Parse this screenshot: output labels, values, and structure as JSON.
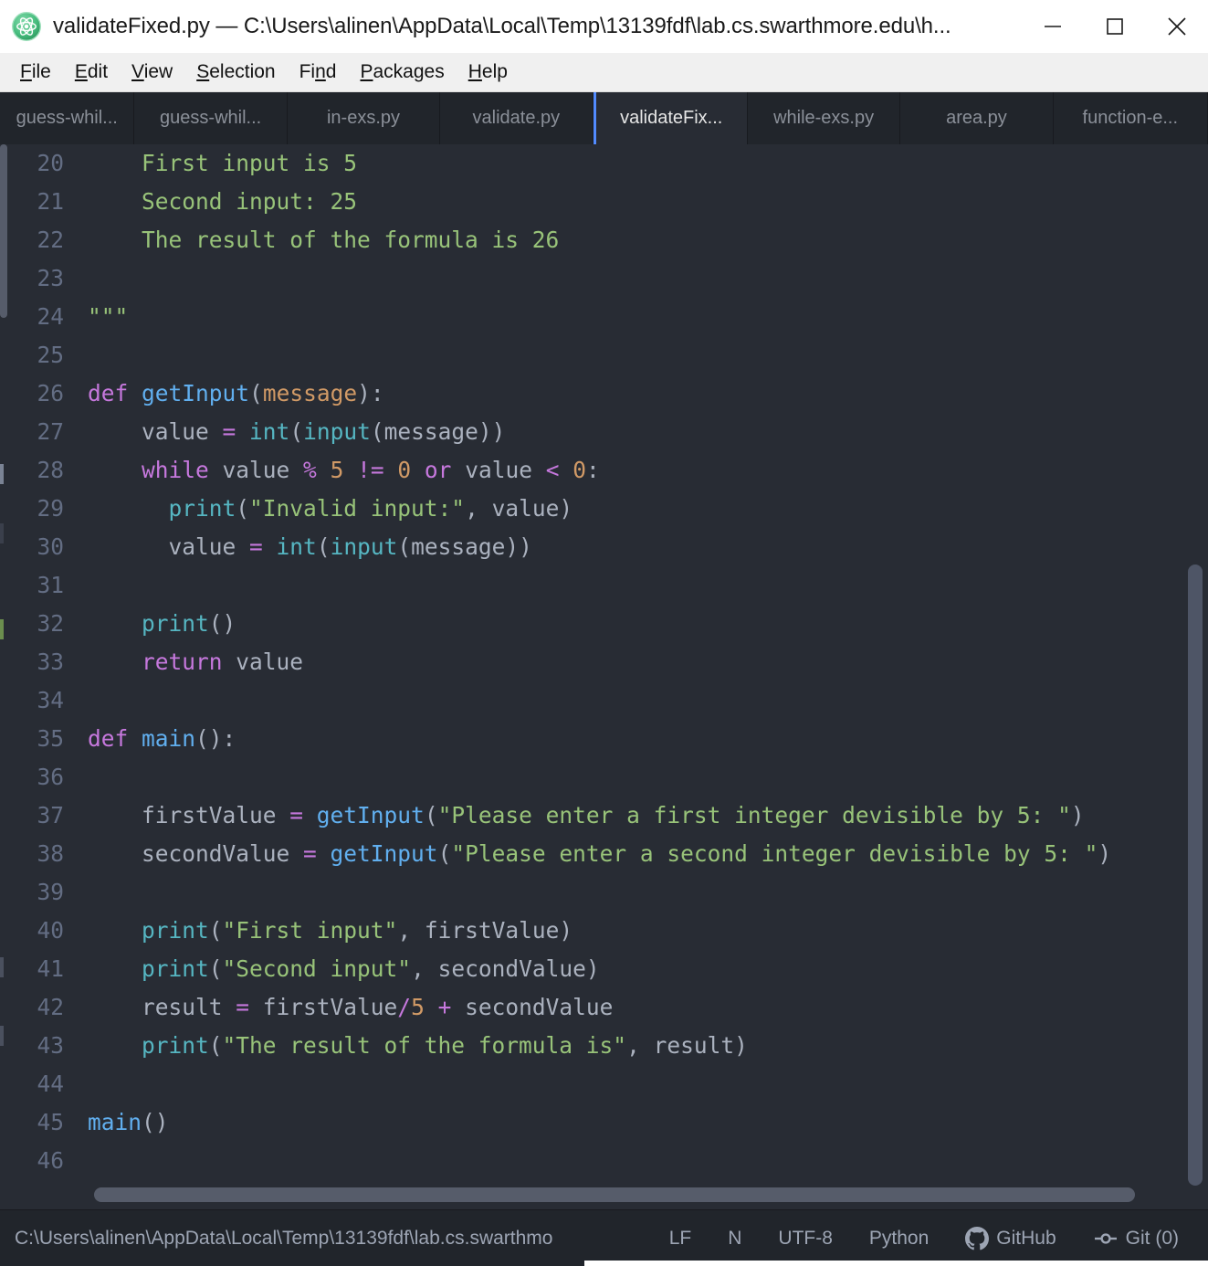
{
  "window": {
    "title": "validateFixed.py — C:\\Users\\alinen\\AppData\\Local\\Temp\\13139fdf\\lab.cs.swarthmore.edu\\h...",
    "app_icon": "atom-icon",
    "minimize_label": "−",
    "maximize_label": "□",
    "close_label": "✕"
  },
  "menu": {
    "items": [
      {
        "label": "File",
        "mnemonic": "F"
      },
      {
        "label": "Edit",
        "mnemonic": "E"
      },
      {
        "label": "View",
        "mnemonic": "V"
      },
      {
        "label": "Selection",
        "mnemonic": "S"
      },
      {
        "label": "Find",
        "mnemonic": "n"
      },
      {
        "label": "Packages",
        "mnemonic": "P"
      },
      {
        "label": "Help",
        "mnemonic": "H"
      }
    ]
  },
  "tabs": [
    {
      "label": "guess-whil...",
      "active": false
    },
    {
      "label": "guess-whil...",
      "active": false
    },
    {
      "label": "in-exs.py",
      "active": false
    },
    {
      "label": "validate.py",
      "active": false
    },
    {
      "label": "validateFix...",
      "active": true
    },
    {
      "label": "while-exs.py",
      "active": false
    },
    {
      "label": "area.py",
      "active": false
    },
    {
      "label": "function-e...",
      "active": false
    }
  ],
  "editor": {
    "first_line_number": 20,
    "lines": [
      {
        "n": 20,
        "tokens": [
          {
            "t": "    First input is 5",
            "c": "t-str"
          }
        ]
      },
      {
        "n": 21,
        "tokens": [
          {
            "t": "    Second input: 25",
            "c": "t-str"
          }
        ]
      },
      {
        "n": 22,
        "tokens": [
          {
            "t": "    The result of the formula is 26",
            "c": "t-str"
          }
        ]
      },
      {
        "n": 23,
        "tokens": []
      },
      {
        "n": 24,
        "tokens": [
          {
            "t": "\"\"\"",
            "c": "t-str"
          }
        ]
      },
      {
        "n": 25,
        "tokens": []
      },
      {
        "n": 26,
        "tokens": [
          {
            "t": "def",
            "c": "t-def"
          },
          {
            "t": " ",
            "c": "t-var"
          },
          {
            "t": "getInput",
            "c": "t-fn"
          },
          {
            "t": "(",
            "c": "t-punc"
          },
          {
            "t": "message",
            "c": "t-param"
          },
          {
            "t": "):",
            "c": "t-punc"
          }
        ]
      },
      {
        "n": 27,
        "tokens": [
          {
            "t": "    value ",
            "c": "t-var"
          },
          {
            "t": "=",
            "c": "t-op"
          },
          {
            "t": " ",
            "c": "t-var"
          },
          {
            "t": "int",
            "c": "t-builtin"
          },
          {
            "t": "(",
            "c": "t-punc"
          },
          {
            "t": "input",
            "c": "t-builtin"
          },
          {
            "t": "(",
            "c": "t-punc"
          },
          {
            "t": "message",
            "c": "t-var"
          },
          {
            "t": "))",
            "c": "t-punc"
          }
        ]
      },
      {
        "n": 28,
        "tokens": [
          {
            "t": "    ",
            "c": "t-var"
          },
          {
            "t": "while",
            "c": "t-def"
          },
          {
            "t": " value ",
            "c": "t-var"
          },
          {
            "t": "%",
            "c": "t-op"
          },
          {
            "t": " ",
            "c": "t-var"
          },
          {
            "t": "5",
            "c": "t-num"
          },
          {
            "t": " ",
            "c": "t-var"
          },
          {
            "t": "!=",
            "c": "t-op"
          },
          {
            "t": " ",
            "c": "t-var"
          },
          {
            "t": "0",
            "c": "t-num"
          },
          {
            "t": " ",
            "c": "t-var"
          },
          {
            "t": "or",
            "c": "t-def"
          },
          {
            "t": " value ",
            "c": "t-var"
          },
          {
            "t": "<",
            "c": "t-op"
          },
          {
            "t": " ",
            "c": "t-var"
          },
          {
            "t": "0",
            "c": "t-num"
          },
          {
            "t": ":",
            "c": "t-punc"
          }
        ]
      },
      {
        "n": 29,
        "tokens": [
          {
            "t": "      ",
            "c": "t-var"
          },
          {
            "t": "print",
            "c": "t-builtin"
          },
          {
            "t": "(",
            "c": "t-punc"
          },
          {
            "t": "\"Invalid input:\"",
            "c": "t-str"
          },
          {
            "t": ", ",
            "c": "t-punc"
          },
          {
            "t": "value",
            "c": "t-var"
          },
          {
            "t": ")",
            "c": "t-punc"
          }
        ]
      },
      {
        "n": 30,
        "tokens": [
          {
            "t": "      value ",
            "c": "t-var"
          },
          {
            "t": "=",
            "c": "t-op"
          },
          {
            "t": " ",
            "c": "t-var"
          },
          {
            "t": "int",
            "c": "t-builtin"
          },
          {
            "t": "(",
            "c": "t-punc"
          },
          {
            "t": "input",
            "c": "t-builtin"
          },
          {
            "t": "(",
            "c": "t-punc"
          },
          {
            "t": "message",
            "c": "t-var"
          },
          {
            "t": "))",
            "c": "t-punc"
          }
        ]
      },
      {
        "n": 31,
        "tokens": []
      },
      {
        "n": 32,
        "tokens": [
          {
            "t": "    ",
            "c": "t-var"
          },
          {
            "t": "print",
            "c": "t-builtin"
          },
          {
            "t": "()",
            "c": "t-punc"
          }
        ]
      },
      {
        "n": 33,
        "tokens": [
          {
            "t": "    ",
            "c": "t-var"
          },
          {
            "t": "return",
            "c": "t-def"
          },
          {
            "t": " value",
            "c": "t-var"
          }
        ]
      },
      {
        "n": 34,
        "tokens": []
      },
      {
        "n": 35,
        "tokens": [
          {
            "t": "def",
            "c": "t-def"
          },
          {
            "t": " ",
            "c": "t-var"
          },
          {
            "t": "main",
            "c": "t-fn"
          },
          {
            "t": "():",
            "c": "t-punc"
          }
        ]
      },
      {
        "n": 36,
        "tokens": []
      },
      {
        "n": 37,
        "tokens": [
          {
            "t": "    firstValue ",
            "c": "t-var"
          },
          {
            "t": "=",
            "c": "t-op"
          },
          {
            "t": " ",
            "c": "t-var"
          },
          {
            "t": "getInput",
            "c": "t-fn"
          },
          {
            "t": "(",
            "c": "t-punc"
          },
          {
            "t": "\"Please enter a first integer devisible by 5: \"",
            "c": "t-str"
          },
          {
            "t": ")",
            "c": "t-punc"
          }
        ]
      },
      {
        "n": 38,
        "tokens": [
          {
            "t": "    secondValue ",
            "c": "t-var"
          },
          {
            "t": "=",
            "c": "t-op"
          },
          {
            "t": " ",
            "c": "t-var"
          },
          {
            "t": "getInput",
            "c": "t-fn"
          },
          {
            "t": "(",
            "c": "t-punc"
          },
          {
            "t": "\"Please enter a second integer devisible by 5: \"",
            "c": "t-str"
          },
          {
            "t": ")",
            "c": "t-punc"
          }
        ]
      },
      {
        "n": 39,
        "tokens": []
      },
      {
        "n": 40,
        "tokens": [
          {
            "t": "    ",
            "c": "t-var"
          },
          {
            "t": "print",
            "c": "t-builtin"
          },
          {
            "t": "(",
            "c": "t-punc"
          },
          {
            "t": "\"First input\"",
            "c": "t-str"
          },
          {
            "t": ", ",
            "c": "t-punc"
          },
          {
            "t": "firstValue",
            "c": "t-var"
          },
          {
            "t": ")",
            "c": "t-punc"
          }
        ]
      },
      {
        "n": 41,
        "tokens": [
          {
            "t": "    ",
            "c": "t-var"
          },
          {
            "t": "print",
            "c": "t-builtin"
          },
          {
            "t": "(",
            "c": "t-punc"
          },
          {
            "t": "\"Second input\"",
            "c": "t-str"
          },
          {
            "t": ", ",
            "c": "t-punc"
          },
          {
            "t": "secondValue",
            "c": "t-var"
          },
          {
            "t": ")",
            "c": "t-punc"
          }
        ]
      },
      {
        "n": 42,
        "tokens": [
          {
            "t": "    result ",
            "c": "t-var"
          },
          {
            "t": "=",
            "c": "t-op"
          },
          {
            "t": " firstValue",
            "c": "t-var"
          },
          {
            "t": "/",
            "c": "t-op"
          },
          {
            "t": "5",
            "c": "t-num"
          },
          {
            "t": " ",
            "c": "t-var"
          },
          {
            "t": "+",
            "c": "t-op"
          },
          {
            "t": " secondValue",
            "c": "t-var"
          }
        ]
      },
      {
        "n": 43,
        "tokens": [
          {
            "t": "    ",
            "c": "t-var"
          },
          {
            "t": "print",
            "c": "t-builtin"
          },
          {
            "t": "(",
            "c": "t-punc"
          },
          {
            "t": "\"The result of the formula is\"",
            "c": "t-str"
          },
          {
            "t": ", ",
            "c": "t-punc"
          },
          {
            "t": "result",
            "c": "t-var"
          },
          {
            "t": ")",
            "c": "t-punc"
          }
        ]
      },
      {
        "n": 44,
        "tokens": []
      },
      {
        "n": 45,
        "tokens": [
          {
            "t": "main",
            "c": "t-fn"
          },
          {
            "t": "()",
            "c": "t-punc"
          }
        ]
      },
      {
        "n": 46,
        "tokens": []
      }
    ]
  },
  "statusbar": {
    "path": "C:\\Users\\alinen\\AppData\\Local\\Temp\\13139fdf\\lab.cs.swarthmo",
    "line_ending": "LF",
    "indent": "N",
    "encoding": "UTF-8",
    "grammar": "Python",
    "github": "GitHub",
    "git": "Git (0)"
  },
  "colors": {
    "background": "#282c34",
    "chrome": "#21252b",
    "accent": "#528bff",
    "gutter_text": "#636d83",
    "keyword": "#c678dd",
    "function": "#61afef",
    "builtin": "#56b6c2",
    "string": "#98c379",
    "number": "#d19a66",
    "text": "#abb2bf",
    "titlebar": "#ffffff",
    "menubar": "#f0f0f0"
  }
}
